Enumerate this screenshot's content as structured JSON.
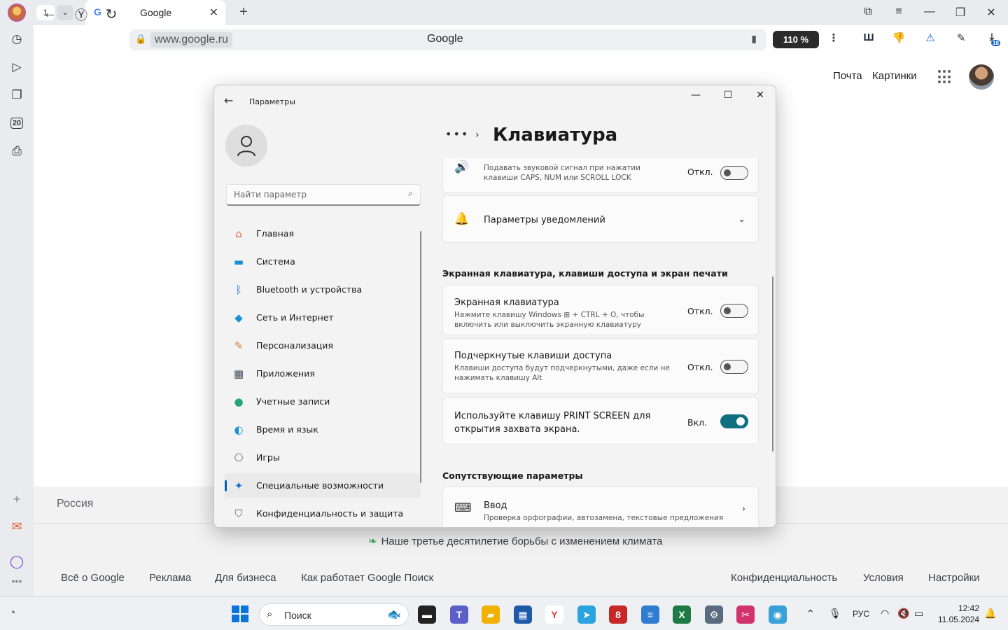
{
  "browser": {
    "tab_count": "1",
    "tab_list_glyph": "⌄",
    "tab_title": "Google",
    "tab_favicon": "G",
    "url": "www.google.ru",
    "page_title": "Google",
    "zoom": "110 %",
    "close_glyph": "✕",
    "new_tab_glyph": "+",
    "extensions": [
      {
        "name": "ublock-extension",
        "glyph": "Ш",
        "color": "#1a2a3a"
      },
      {
        "name": "dislike-extension",
        "glyph": "👎",
        "color": "#c62828"
      },
      {
        "name": "notification-extension",
        "glyph": "⚠",
        "color": "#1565c0"
      },
      {
        "name": "translate-extension",
        "glyph": "✎",
        "color": "#333333"
      }
    ],
    "downloads_badge": "18",
    "rail_badge": "20"
  },
  "google": {
    "mail_link": "Почта",
    "images_link": "Картинки",
    "country": "Россия",
    "climate_text": "Наше третье десятилетие борьбы с изменением климата",
    "footer_left": [
      "Всё о Google",
      "Реклама",
      "Для бизнеса",
      "Как работает Google Поиск"
    ],
    "footer_right": [
      "Конфиденциальность",
      "Условия",
      "Настройки"
    ]
  },
  "settings": {
    "window_title": "Параметры",
    "search_placeholder": "Найти параметр",
    "breadcrumb_dots": "•••",
    "page_title": "Клавиатура",
    "nav": [
      {
        "label": "Главная",
        "icon": "home-icon",
        "glyph": "⌂",
        "color": "#e8663c"
      },
      {
        "label": "Система",
        "icon": "system-icon",
        "glyph": "▬",
        "color": "#1a8fd6"
      },
      {
        "label": "Bluetooth и устройства",
        "icon": "bluetooth-icon",
        "glyph": "ᛒ",
        "color": "#1a6fd6"
      },
      {
        "label": "Сеть и Интернет",
        "icon": "wifi-icon",
        "glyph": "◆",
        "color": "#1a8fd6"
      },
      {
        "label": "Персонализация",
        "icon": "brush-icon",
        "glyph": "✎",
        "color": "#d8803a"
      },
      {
        "label": "Приложения",
        "icon": "apps-icon",
        "glyph": "▦",
        "color": "#3a4a5a"
      },
      {
        "label": "Учетные записи",
        "icon": "accounts-icon",
        "glyph": "●",
        "color": "#22a37a"
      },
      {
        "label": "Время и язык",
        "icon": "time-language-icon",
        "glyph": "◐",
        "color": "#1a8fd6"
      },
      {
        "label": "Игры",
        "icon": "gamepad-icon",
        "glyph": "⎔",
        "color": "#666666"
      },
      {
        "label": "Специальные возможности",
        "icon": "accessibility-icon",
        "glyph": "✦",
        "color": "#1a6fd6"
      },
      {
        "label": "Конфиденциальность и защита",
        "icon": "shield-icon",
        "glyph": "⛉",
        "color": "#666666"
      }
    ],
    "active_nav": "Специальные возможности",
    "sound_card": {
      "desc": "Подавать звуковой сигнал при нажатии клавиши CAPS, NUM или SCROLL LOCK",
      "state": "Откл."
    },
    "notifications_card": {
      "title": "Параметры уведомлений"
    },
    "section_title": "Экранная клавиатура, клавиши доступа и экран печати",
    "osk_card": {
      "title": "Экранная клавиатура",
      "desc_before_logo": "Нажмите клавишу Windows",
      "desc_after_logo": "+ CTRL + O, чтобы включить или выключить экранную клавиатуру",
      "state": "Откл."
    },
    "access_keys_card": {
      "title": "Подчеркнутые клавиши доступа",
      "desc": "Клавиши доступа будут подчеркнутыми, даже если не нажимать клавишу Alt",
      "state": "Откл."
    },
    "printscreen_card": {
      "title": "Используйте клавишу PRINT SCREEN для открытия захвата экрана.",
      "state": "Вкл."
    },
    "related_title": "Сопутствующие параметры",
    "input_card": {
      "title": "Ввод",
      "desc": "Проверка орфографии, автозамена, текстовые предложения"
    }
  },
  "taskbar": {
    "search_label": "Поиск",
    "language": "РУС",
    "time": "12:42",
    "date": "11.05.2024",
    "apps": [
      {
        "name": "taskview-app",
        "glyph": "▬",
        "bg": "#222222"
      },
      {
        "name": "teams-app",
        "glyph": "T",
        "bg": "#5b5fc7"
      },
      {
        "name": "explorer-app",
        "glyph": "▰",
        "bg": "#f2b100"
      },
      {
        "name": "store-app",
        "glyph": "▦",
        "bg": "#1e5aa8"
      },
      {
        "name": "yandex-browser-app",
        "glyph": "Y",
        "bg": "#ffffff"
      },
      {
        "name": "telegram-app",
        "glyph": "➤",
        "bg": "#2aa3e0"
      },
      {
        "name": "opera-app",
        "glyph": "8",
        "bg": "#c62828"
      },
      {
        "name": "notepad-app",
        "glyph": "≡",
        "bg": "#2f7dd1"
      },
      {
        "name": "excel-app",
        "glyph": "X",
        "bg": "#1d7a45"
      },
      {
        "name": "settings-app",
        "glyph": "⚙",
        "bg": "#5a6b80"
      },
      {
        "name": "snipping-app",
        "glyph": "✂",
        "bg": "#d2336b"
      },
      {
        "name": "maps-app",
        "glyph": "◉",
        "bg": "#3aa0d8"
      }
    ]
  }
}
